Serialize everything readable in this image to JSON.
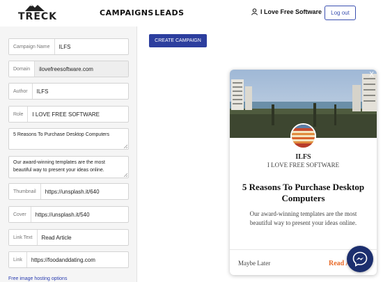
{
  "header": {
    "logo_text": "TRECK",
    "nav": [
      "CAMPAIGNS",
      "LEADS"
    ],
    "user_name": "I Love Free Software",
    "logout_label": "Log out"
  },
  "form": {
    "campaign_name": {
      "label": "Campaign Name",
      "value": "ILFS"
    },
    "domain": {
      "label": "Domain",
      "value": "ilovefreesoftware.com"
    },
    "author": {
      "label": "Author",
      "value": "ILFS"
    },
    "role": {
      "label": "Role",
      "value": "I LOVE FREE SOFTWARE"
    },
    "title_text": "5 Reasons To Purchase Desktop Computers",
    "description_text": "Our award-winning templates are the most beautiful way to present your ideas online.",
    "thumbnail": {
      "label": "Thumbnail",
      "value": "https://unsplash.it/640"
    },
    "cover": {
      "label": "Cover",
      "value": "https://unsplash.it/540"
    },
    "link_text": {
      "label": "Link Text",
      "value": "Read Article"
    },
    "link": {
      "label": "Link",
      "value": "https://foodanddating.com"
    },
    "footer_link": "Free image hosting options"
  },
  "create_button": "CREATE CAMPAIGN",
  "popup": {
    "close": "X",
    "author": "ILFS",
    "role": "I LOVE FREE SOFTWARE",
    "title": "5 Reasons To Purchase Desktop Computers",
    "description": "Our award-winning templates are the most beautiful way to present your ideas online.",
    "maybe_later": "Maybe Later",
    "read_article": "Read Article"
  },
  "colors": {
    "accent": "#2c3e9e",
    "read_link": "#e86a28",
    "messenger_bg": "#1c2f6e"
  },
  "icons": [
    "mountain-logo-icon",
    "user-icon",
    "close-icon",
    "messenger-icon"
  ]
}
